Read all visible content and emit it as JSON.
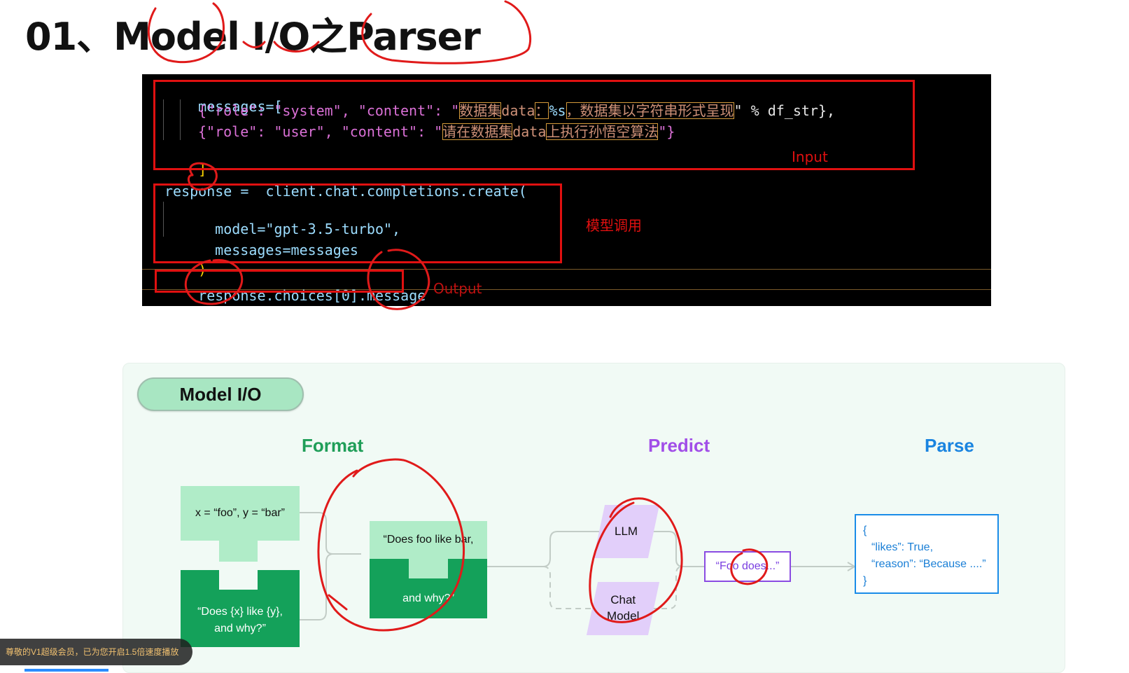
{
  "title": "01、Model I/O之Parser",
  "code": {
    "messages_open": "messages=[",
    "line1_pre": "{\"role\": \"system\", \"content\": \"",
    "line1_hl1": "数据集",
    "line1_data": "data",
    "line1_colon": "：",
    "line1_fmt": "%s",
    "line1_hl2": "，数据集以字符串形式呈现",
    "line1_post": "\" % df_str},",
    "line2_pre": "{\"role\": \"user\", \"content\": \"",
    "line2_hl1": "请在数据集",
    "line2_data": "data",
    "line2_hl2": "上执行孙悟空算法",
    "line2_post": "\"}",
    "messages_close": "]",
    "resp_line": "response = ",
    "resp_call": "client.chat.completions.create(",
    "model_line": "model=\"gpt-3.5-turbo\",",
    "msgs_line": "messages=messages",
    "close_paren": ")",
    "out_line": "response.choices[0].message"
  },
  "labels": {
    "input": "Input",
    "model_call": "模型调用",
    "output": "Output"
  },
  "diagram": {
    "badge": "Model I/O",
    "format": "Format",
    "predict": "Predict",
    "parse": "Parse",
    "vars_card": "x = “foo”, y = “bar”",
    "template_card": "“Does {x} like {y}, and why?”",
    "prompt_top": "“Does foo like bar,",
    "prompt_bottom": "and why?”",
    "llm": "LLM",
    "chat_model": "Chat Model",
    "output_text": "“Foo does...”",
    "json_open": "{",
    "json_likes": "“likes”: True,",
    "json_reason": "“reason”: “Because ....”",
    "json_close": "}",
    "colors": {
      "format": "#1f9e58",
      "predict": "#a14ee8",
      "parse": "#1a84e0"
    }
  },
  "toast": "尊敬的V1超级会员，已为您开启1.5倍速度播放"
}
